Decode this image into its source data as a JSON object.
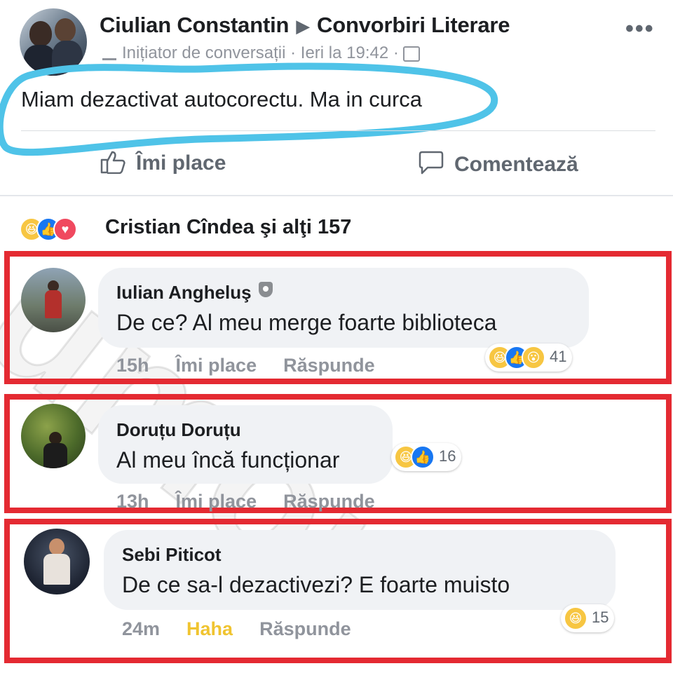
{
  "post": {
    "author": "Ciulian Constantin",
    "arrow": "▶",
    "group": "Convorbiri Literare",
    "subtitle": "Inițiator de conversații · Ieri la 19:42 ·",
    "text": "Miam dezactivat autocorectu. Ma in curca",
    "more": "•••"
  },
  "actions": {
    "like_label": "Îmi place",
    "comment_label": "Comentează"
  },
  "reactions": {
    "summary": "Cristian Cîndea şi alţi 157",
    "types": [
      "haha",
      "like",
      "love"
    ]
  },
  "comments": [
    {
      "name": "Iulian Angheluş",
      "text": "De ce?  Al meu merge foarte biblioteca",
      "time": "15h",
      "like": "Îmi place",
      "reply": "Răspunde",
      "reaction_count": "41",
      "reactions": [
        "haha",
        "like",
        "wow"
      ]
    },
    {
      "name": "Doruțu Doruțu",
      "text": "Al meu încă funcționar",
      "time": "13h",
      "like": "Îmi place",
      "reply": "Răspunde",
      "reaction_count": "16",
      "reactions": [
        "haha",
        "like"
      ]
    },
    {
      "name": "Sebi Piticot",
      "text": "De ce sa-l dezactivezi? E foarte muisto",
      "time": "24m",
      "like": "Haha",
      "reply": "Răspunde",
      "reaction_count": "15",
      "reactions": [
        "haha"
      ]
    }
  ],
  "watermark": "umor",
  "colors": {
    "highlight_blue": "#4fc3e8",
    "highlight_red": "#e42a32",
    "like_blue": "#1877f2",
    "haha_yellow": "#f7c642",
    "love_red": "#f0495f"
  }
}
